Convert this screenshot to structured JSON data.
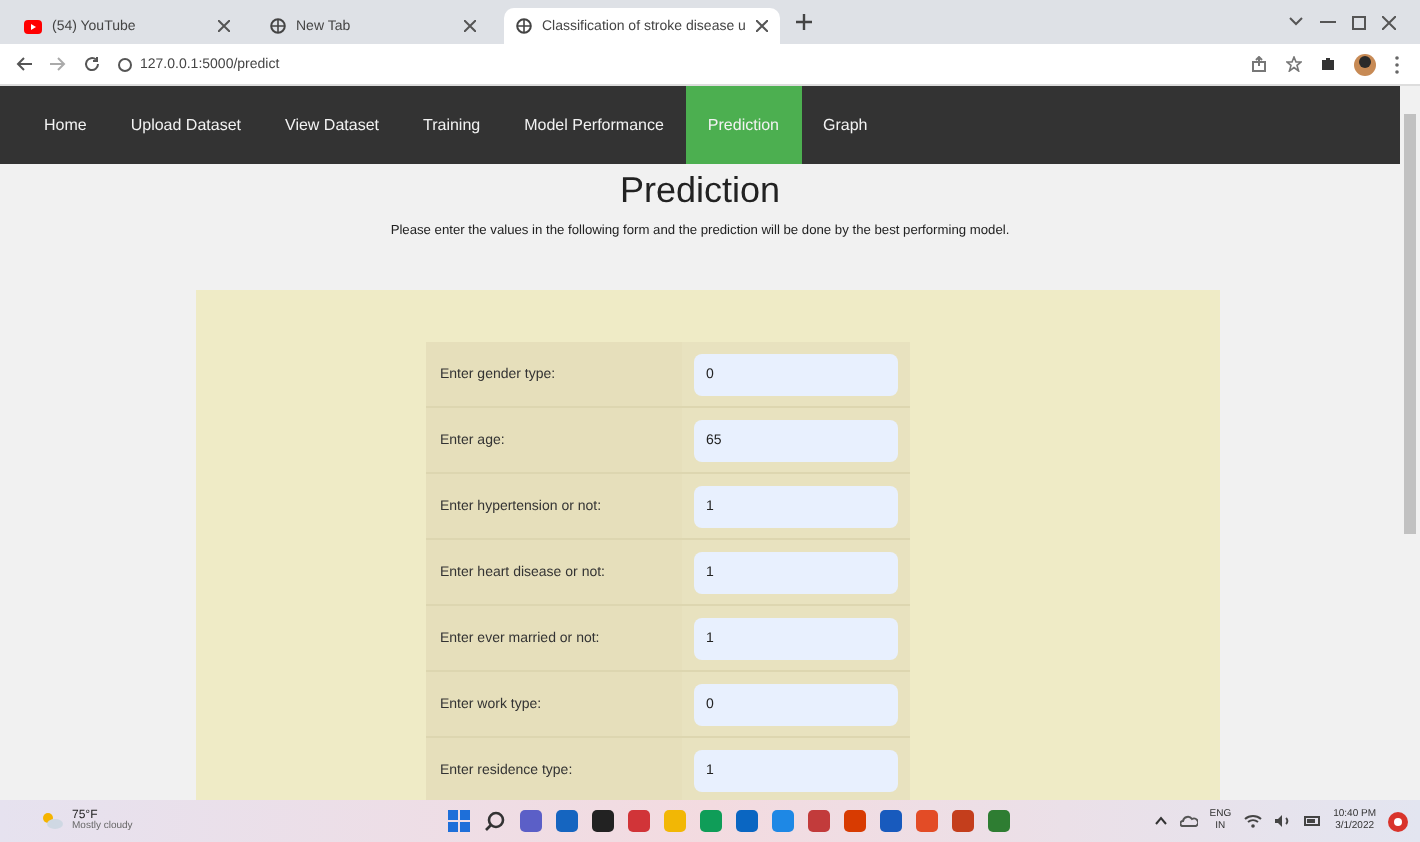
{
  "browser_tabs": [
    {
      "title": "(54) YouTube",
      "kind": "youtube",
      "selected": false
    },
    {
      "title": "New Tab",
      "kind": "globe",
      "selected": false
    },
    {
      "title": "Classification of stroke disease u",
      "kind": "globe",
      "selected": true
    }
  ],
  "address_bar": {
    "url": "127.0.0.1:5000/predict"
  },
  "nav": [
    {
      "label": "Home",
      "selected": false
    },
    {
      "label": "Upload Dataset",
      "selected": false
    },
    {
      "label": "View Dataset",
      "selected": false
    },
    {
      "label": "Training",
      "selected": false
    },
    {
      "label": "Model Performance",
      "selected": false
    },
    {
      "label": "Prediction",
      "selected": true
    },
    {
      "label": "Graph",
      "selected": false
    }
  ],
  "page": {
    "title": "Prediction",
    "intro": "Please enter the values in the following form and the prediction will be done by the best performing model."
  },
  "form": [
    {
      "label": "Enter gender type:",
      "value": "0"
    },
    {
      "label": "Enter age:",
      "value": "65"
    },
    {
      "label": "Enter hypertension or not:",
      "value": "1"
    },
    {
      "label": "Enter heart disease or not:",
      "value": "1"
    },
    {
      "label": "Enter ever married or not:",
      "value": "1"
    },
    {
      "label": "Enter work type:",
      "value": "0"
    },
    {
      "label": "Enter residence type:",
      "value": "1"
    }
  ],
  "taskbar": {
    "weather_temp": "75°F",
    "weather_text": "Mostly cloudy",
    "lang": "ENG",
    "lang_sub": "IN",
    "time": "10:40 PM",
    "date": "3/1/2022"
  }
}
